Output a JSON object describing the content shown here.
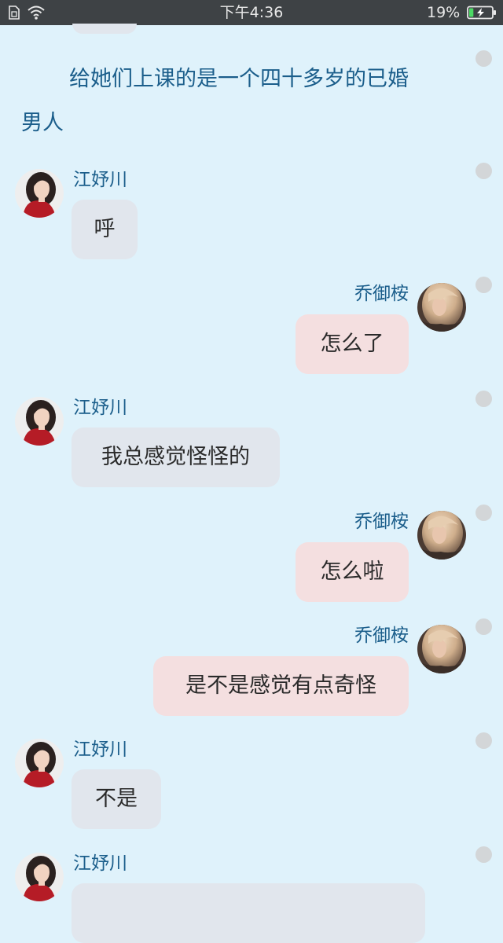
{
  "status_bar": {
    "time": "下午4:36",
    "battery_percent": "19%",
    "sim_icon": "sim-card-icon",
    "wifi_icon": "wifi-icon",
    "battery_icon": "battery-charging-icon",
    "battery_level": 0.19
  },
  "colors": {
    "background": "#dff2fb",
    "narration_text": "#1b5e8b",
    "left_bubble": "#e1e6ed",
    "right_bubble": "#f4dfe0",
    "status_bar": "#3e4245",
    "battery_fill": "#4cd964"
  },
  "narration": {
    "line1": "给她们上课的是一个四十多岁的已婚",
    "line2": "男人"
  },
  "characters": {
    "left": {
      "name": "江妤川",
      "avatar": "avatar-girl-red-dress"
    },
    "right": {
      "name": "乔御桉",
      "avatar": "avatar-blonde-girl"
    }
  },
  "messages": [
    {
      "side": "left",
      "name": "江妤川",
      "text": "呼"
    },
    {
      "side": "right",
      "name": "乔御桉",
      "text": "怎么了"
    },
    {
      "side": "left",
      "name": "江妤川",
      "text": "我总感觉怪怪的"
    },
    {
      "side": "right",
      "name": "乔御桉",
      "text": "怎么啦"
    },
    {
      "side": "right",
      "name": "乔御桉",
      "text": "是不是感觉有点奇怪"
    },
    {
      "side": "left",
      "name": "江妤川",
      "text": "不是"
    },
    {
      "side": "left",
      "name": "江妤川",
      "text": ""
    }
  ]
}
